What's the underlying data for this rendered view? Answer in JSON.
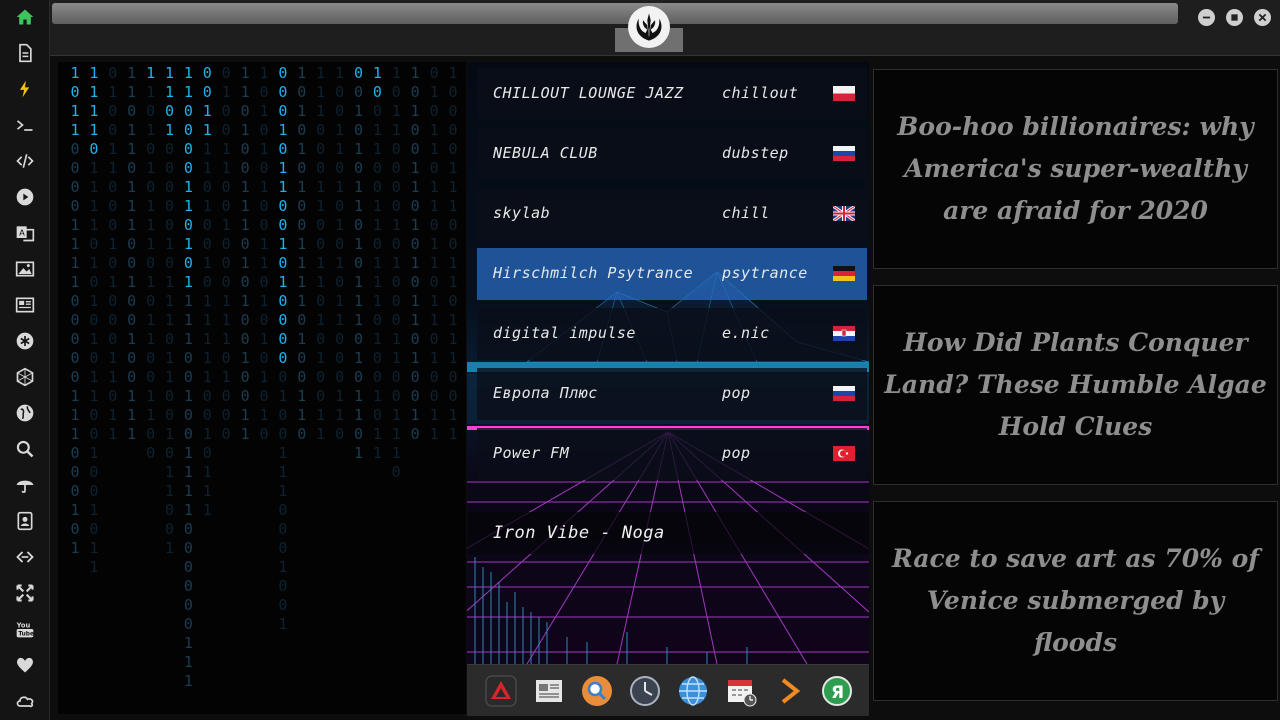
{
  "icons": {
    "sidebar": [
      "home-icon",
      "document-icon",
      "bolt-icon",
      "terminal-icon",
      "code-icon",
      "play-icon",
      "translate-icon",
      "image-icon",
      "newspaper-icon",
      "asterisk-icon",
      "hexagon-icon",
      "globe-icon",
      "search-icon",
      "umbrella-icon",
      "contacts-icon",
      "link-icon",
      "expand-icon",
      "youtube-icon",
      "heart-icon",
      "cloud-icon"
    ],
    "window_controls": [
      "minimize-icon",
      "maximize-icon",
      "close-icon"
    ],
    "dock": [
      "vector-app-icon",
      "news-app-icon",
      "search-app-icon",
      "clock-icon",
      "globe-icon",
      "calendar-icon",
      "forward-icon",
      "yandex-icon"
    ]
  },
  "colors": {
    "matrix_bright": "#1fb2ec",
    "matrix_dim": "#1a3d52",
    "matrix_faint": "#0d2230",
    "active_station": "#2a6ec8",
    "sidebar_home": "#3fc35a",
    "sidebar_bolt": "#f1c40f",
    "news_text": "#8e8e8e"
  },
  "matrix": {
    "columns": [
      {
        "lit": "1011",
        "rest": "0000111100000111000101"
      },
      {
        "lit": "11110",
        "rest": "1111010101011001001011"
      },
      {
        "lit": "",
        "rest": "01001100010100011011"
      },
      {
        "lit": "",
        "rest": "11011011100100100111"
      },
      {
        "lit": "1",
        "rest": "10101011101011001100"
      },
      {
        "lit": "1101",
        "rest": "0000010111011001011001"
      },
      {
        "lit": "110000110101",
        "rest": "111001001111000000111"
      },
      {
        "lit": "0011",
        "rest": "11010010111110010111"
      },
      {
        "lit": "",
        "rest": "01001100100011101000"
      },
      {
        "lit": "",
        "rest": "11010011101010010011"
      },
      {
        "lit": "",
        "rest": "10101010011010101010"
      },
      {
        "lit": "0001011001010000",
        "rest": "01001110001001"
      },
      {
        "lit": "",
        "rest": "10101010011110100110"
      },
      {
        "lit": "",
        "rest": "11100011001101010011"
      },
      {
        "lit": "",
        "rest": "10011010101011000110"
      },
      {
        "lit": "0",
        "rest": "01010110101110101101"
      },
      {
        "lit": "10",
        "rest": "0110011011101001011"
      },
      {
        "lit": "",
        "rest": "1011000010100011001110"
      },
      {
        "lit": "",
        "rest": "10100110101011010010"
      },
      {
        "lit": "",
        "rest": "01011011011011010011"
      },
      {
        "lit": "",
        "rest": "10000111001101110011"
      },
      {
        "lit": "",
        "rest": "10100011011010101010"
      }
    ]
  },
  "radio": {
    "stations": [
      {
        "name": "CHILLOUT LOUNGE JAZZ",
        "genre": "chillout",
        "flag": "poland",
        "active": false
      },
      {
        "name": "NEBULA CLUB",
        "genre": "dubstep",
        "flag": "russia",
        "active": false
      },
      {
        "name": "skylab",
        "genre": "chill",
        "flag": "uk",
        "active": false
      },
      {
        "name": "Hirschmilch Psytrance",
        "genre": "psytrance",
        "flag": "germany",
        "active": true
      },
      {
        "name": "digital impulse",
        "genre": "e.nic",
        "flag": "croatia",
        "active": false
      },
      {
        "name": "Европа Плюс",
        "genre": "pop",
        "flag": "russia",
        "active": false
      },
      {
        "name": "Power FM",
        "genre": "pop",
        "flag": "turkey",
        "active": false
      }
    ],
    "now_playing": "Iron Vibe - Noga"
  },
  "news": [
    {
      "headline": "Boo-hoo billionaires: why America's super-wealthy are afraid for 2020"
    },
    {
      "headline": "How Did Plants Conquer Land? These Humble Algae Hold Clues"
    },
    {
      "headline": "Race to save art as 70% of Venice submerged by floods"
    }
  ]
}
